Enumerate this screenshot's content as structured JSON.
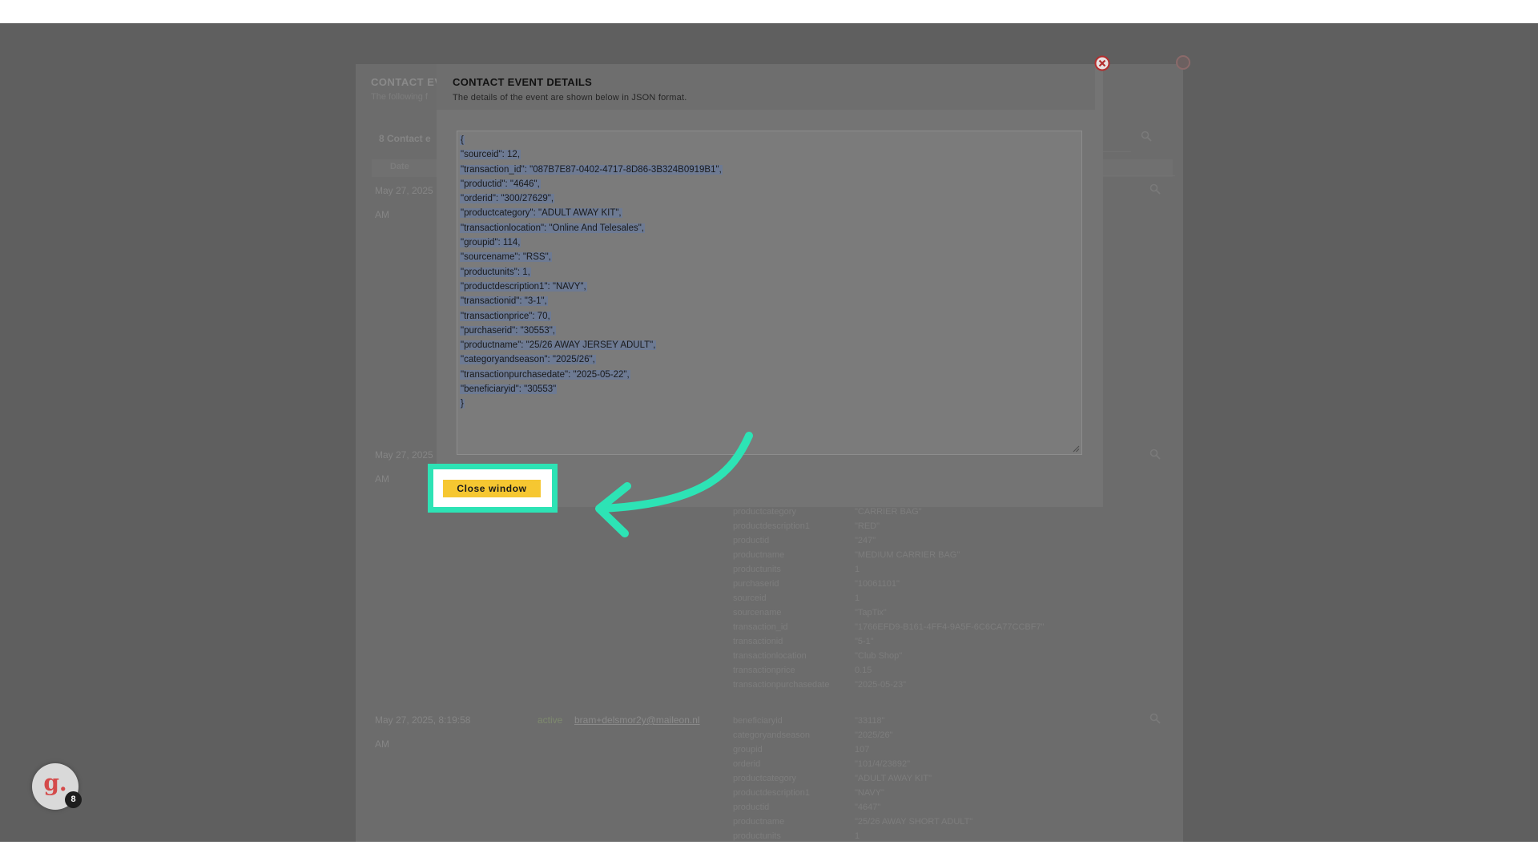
{
  "background": {
    "panel_title": "CONTACT EV",
    "panel_subtitle": "The following f",
    "events_count": "8 Contact e",
    "date_column": "Date",
    "rows": [
      {
        "date": "May 27, 2025",
        "time": "AM"
      },
      {
        "date": "May 27, 2025",
        "time": "AM"
      },
      {
        "date": "May 27, 2025, 8:19:58",
        "time": "AM",
        "status": "active",
        "email": "bram+delsmor2y@maileon.nl"
      }
    ],
    "details_block_1": [
      {
        "key": "productcategory",
        "value": "\"CARRIER BAG\""
      },
      {
        "key": "productdescription1",
        "value": "\"RED\""
      },
      {
        "key": "productid",
        "value": "\"247\""
      },
      {
        "key": "productname",
        "value": "\"MEDIUM CARRIER BAG\""
      },
      {
        "key": "productunits",
        "value": "1"
      },
      {
        "key": "purchaserid",
        "value": "\"10061101\""
      },
      {
        "key": "sourceid",
        "value": "1"
      },
      {
        "key": "sourcename",
        "value": "\"TapTix\""
      },
      {
        "key": "transaction_id",
        "value": "\"1766EFD9-B161-4FF4-9A5F-6C6CA77CCBF7\""
      },
      {
        "key": "transactionid",
        "value": "\"5-1\""
      },
      {
        "key": "transactionlocation",
        "value": "\"Club Shop\""
      },
      {
        "key": "transactionprice",
        "value": "0.15"
      },
      {
        "key": "transactionpurchasedate",
        "value": "\"2025-05-23\""
      }
    ],
    "details_block_2": [
      {
        "key": "beneficiaryid",
        "value": "\"33118\""
      },
      {
        "key": "categoryandseason",
        "value": "\"2025/26\""
      },
      {
        "key": "groupid",
        "value": "107"
      },
      {
        "key": "orderid",
        "value": "\"101/4/23892\""
      },
      {
        "key": "productcategory",
        "value": "\"ADULT AWAY KIT\""
      },
      {
        "key": "productdescription1",
        "value": "\"NAVY\""
      },
      {
        "key": "productid",
        "value": "\"4647\""
      },
      {
        "key": "productname",
        "value": "\"25/26 AWAY SHORT ADULT\""
      },
      {
        "key": "productunits",
        "value": "1"
      }
    ]
  },
  "modal": {
    "title": "CONTACT EVENT DETAILS",
    "subtitle": "The details of the event are shown below in JSON format.",
    "json_lines": [
      "{",
      "\"sourceid\": 12,",
      "\"transaction_id\": \"087B7E87-0402-4717-8D86-3B324B0919B1\",",
      "\"productid\": \"4646\",",
      "\"orderid\": \"300/27629\",",
      "\"productcategory\": \"ADULT AWAY KIT\",",
      "\"transactionlocation\": \"Online And Telesales\",",
      "\"groupid\": 114,",
      "\"sourcename\": \"RSS\",",
      "\"productunits\": 1,",
      "\"productdescription1\": \"NAVY\",",
      "\"transactionid\": \"3-1\",",
      "\"transactionprice\": 70,",
      "\"purchaserid\": \"30553\",",
      "\"productname\": \"25/26 AWAY JERSEY ADULT\",",
      "\"categoryandseason\": \"2025/26\",",
      "\"transactionpurchasedate\": \"2025-05-22\",",
      "\"beneficiaryid\": \"30553\"",
      "}"
    ],
    "close_button_label": "Close window"
  },
  "badge": {
    "letter": "g.",
    "count": "8"
  },
  "colors": {
    "highlight_frame": "#2de3b5",
    "button": "#f6c731",
    "overlay": "#5f5f5f",
    "close_icon": "#c0392b"
  },
  "icons": {
    "modal_close": "close-circle-icon",
    "arrow": "curved-arrow-icon",
    "search": "search-icon"
  }
}
